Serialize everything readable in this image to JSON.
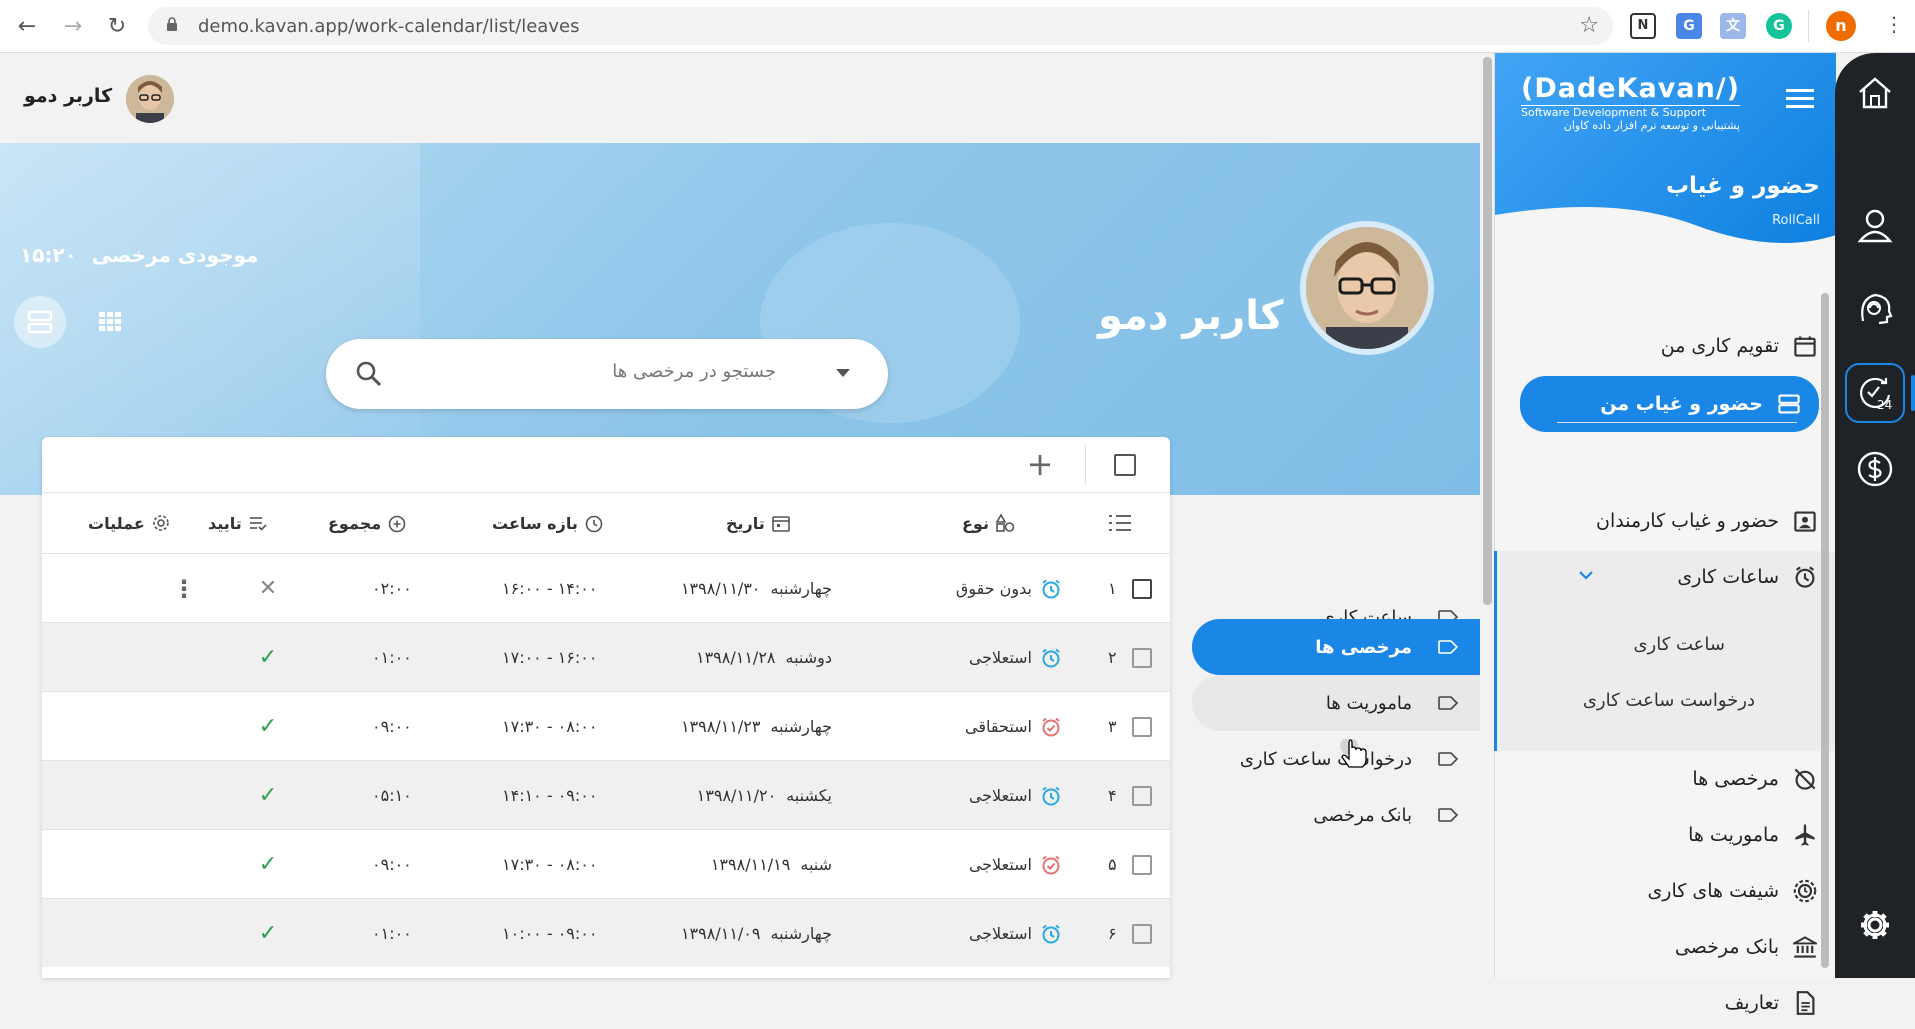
{
  "browser": {
    "url": "demo.kavan.app/work-calendar/list/leaves",
    "profile_initial": "n",
    "ext_n_label": "N",
    "ext_translate_label": "G",
    "ext_grammarly_label": "G"
  },
  "rail": {
    "icons": [
      "home-icon",
      "profile-icon",
      "support-icon",
      "rollcall-24-icon",
      "finance-icon",
      "settings-icon"
    ],
    "accent": "#1a86e6"
  },
  "sidebar": {
    "logo_main": "(DadeKavan/)",
    "logo_sub": "Software Development & Support",
    "logo_fa": "پشتیبانی و توسعه نرم افزار داده کاوان",
    "title": "حضور و غیاب",
    "subtitle": "RollCall",
    "items": [
      {
        "label": "تقویم کاری من",
        "icon": "calendar-icon"
      },
      {
        "label": "حضور و غیاب من",
        "icon": "list-icon",
        "active": true
      },
      {
        "label": "حضور و غیاب کارمندان",
        "icon": "employees-icon"
      },
      {
        "label": "ساعات کاری",
        "icon": "alarm-icon",
        "expanded": true
      },
      {
        "label": "مرخصی ها",
        "icon": "alarm-off-icon"
      },
      {
        "label": "ماموریت ها",
        "icon": "airplane-icon"
      },
      {
        "label": "شیفت های کاری",
        "icon": "shift-icon"
      },
      {
        "label": "بانک مرخصی",
        "icon": "bank-icon"
      },
      {
        "label": "تعاریف",
        "icon": "document-icon"
      }
    ],
    "subitems": [
      {
        "label": "ساعت کاری"
      },
      {
        "label": "درخواست ساعت کاری"
      }
    ]
  },
  "topbar": {
    "user_name": "کاربر دمو"
  },
  "hero": {
    "name": "کاربر دمو",
    "balance_label": "موجودی مرخصی",
    "balance_value": "۱۵:۲۰",
    "search_placeholder": "جستجو در مرخصی ها"
  },
  "subnav": [
    {
      "label": "ساعت کاری"
    },
    {
      "label": "مرخصی ها",
      "active": true
    },
    {
      "label": "ماموریت ها",
      "hover": true
    },
    {
      "label": "درخواست ساعت کاری"
    },
    {
      "label": "بانک مرخصی"
    }
  ],
  "table": {
    "headers": {
      "type": "نوع",
      "date": "تاریخ",
      "time_range": "بازه ساعت",
      "total": "مجموع",
      "approve": "تایید",
      "actions": "عملیات"
    },
    "rows": [
      {
        "num": "۱",
        "type": "بدون حقوق",
        "type_color": "#29a9e0",
        "weekday": "چهارشنبه",
        "date": "۱۳۹۸/۱۱/۳۰",
        "range": "۱۶:۰۰ - ۱۴:۰۰",
        "total": "۰۲:۰۰",
        "status": "rejected",
        "status_glyph": "✕",
        "has_menu": true
      },
      {
        "num": "۲",
        "type": "استعلاجی",
        "type_color": "#29a9e0",
        "weekday": "دوشنبه",
        "date": "۱۳۹۸/۱۱/۲۸",
        "range": "۱۷:۰۰ - ۱۶:۰۰",
        "total": "۰۱:۰۰",
        "status": "approved",
        "status_glyph": "✓"
      },
      {
        "num": "۳",
        "type": "استحقاقی",
        "type_color": "#e57373",
        "weekday": "چهارشنبه",
        "date": "۱۳۹۸/۱۱/۲۳",
        "range": "۱۷:۳۰ - ۰۸:۰۰",
        "total": "۰۹:۰۰",
        "status": "approved",
        "status_glyph": "✓"
      },
      {
        "num": "۴",
        "type": "استعلاجی",
        "type_color": "#29a9e0",
        "weekday": "یکشنبه",
        "date": "۱۳۹۸/۱۱/۲۰",
        "range": "۱۴:۱۰ - ۰۹:۰۰",
        "total": "۰۵:۱۰",
        "status": "approved",
        "status_glyph": "✓"
      },
      {
        "num": "۵",
        "type": "استعلاجی",
        "type_color": "#e57373",
        "weekday": "شنبه",
        "date": "۱۳۹۸/۱۱/۱۹",
        "range": "۱۷:۳۰ - ۰۸:۰۰",
        "total": "۰۹:۰۰",
        "status": "approved",
        "status_glyph": "✓"
      },
      {
        "num": "۶",
        "type": "استعلاجی",
        "type_color": "#29a9e0",
        "weekday": "چهارشنبه",
        "date": "۱۳۹۸/۱۱/۰۹",
        "range": "۱۰:۰۰ - ۰۹:۰۰",
        "total": "۰۱:۰۰",
        "status": "approved",
        "status_glyph": "✓"
      }
    ]
  }
}
